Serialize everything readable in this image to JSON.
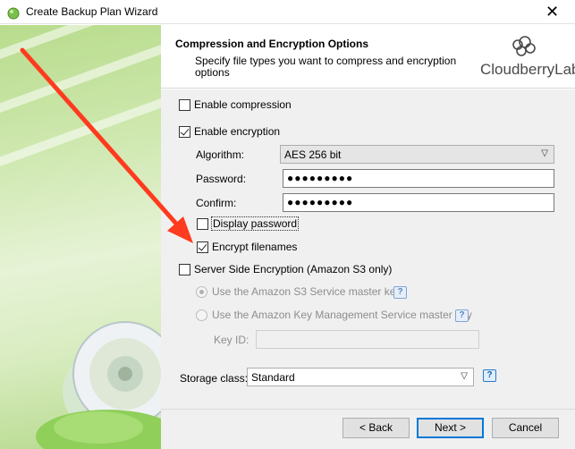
{
  "window": {
    "title": "Create Backup Plan Wizard",
    "close_glyph": "✕"
  },
  "header": {
    "title": "Compression and Encryption Options",
    "subtitle": "Specify file types you want to compress and encryption options",
    "logo_text": "CloudberryLab"
  },
  "compression": {
    "label": "Enable compression",
    "checked": false
  },
  "encryption": {
    "label": "Enable encryption",
    "checked": true,
    "algorithm_label": "Algorithm:",
    "algorithm_value": "AES 256 bit",
    "password_label": "Password:",
    "password_value": "●●●●●●●●●",
    "confirm_label": "Confirm:",
    "confirm_value": "●●●●●●●●●",
    "display_password_label": "Display password",
    "display_password_checked": false,
    "encrypt_filenames_label": "Encrypt filenames",
    "encrypt_filenames_checked": true
  },
  "sse": {
    "label": "Server Side Encryption (Amazon S3 only)",
    "checked": false,
    "option1": "Use the Amazon S3 Service master key",
    "option2": "Use the Amazon Key Management Service master key",
    "key_id_label": "Key ID:",
    "key_id_value": ""
  },
  "storage": {
    "label": "Storage class:",
    "value": "Standard"
  },
  "help_glyph": "?",
  "dropdown_glyph": "▽",
  "buttons": {
    "back": "< Back",
    "next": "Next >",
    "cancel": "Cancel"
  },
  "colors": {
    "arrow": "#ff3b1f",
    "accent": "#0078d7",
    "side_green": "#b8dc8c"
  }
}
